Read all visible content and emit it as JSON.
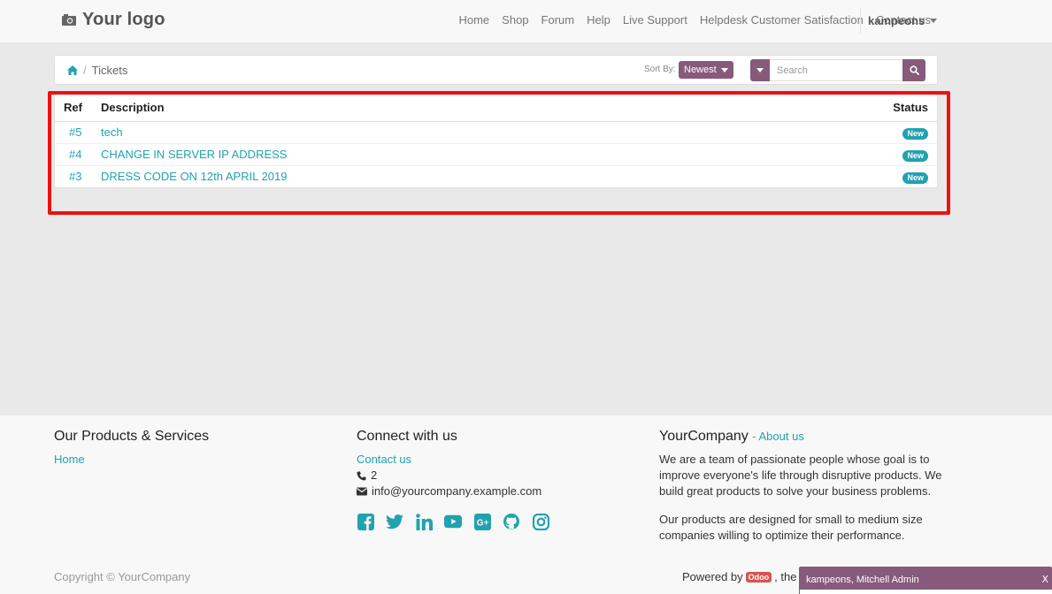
{
  "navbar": {
    "logo_text": "Your logo",
    "menu": [
      "Home",
      "Shop",
      "Forum",
      "Help",
      "Live Support",
      "Helpdesk Customer Satisfaction",
      "Contact us"
    ],
    "user": "kampeons"
  },
  "breadcrumb": {
    "home_icon": "home-icon",
    "separator": "/",
    "current": "Tickets"
  },
  "sort": {
    "label": "Sort By:",
    "value": "Newest"
  },
  "search": {
    "placeholder": "Search"
  },
  "table": {
    "headers": {
      "ref": "Ref",
      "description": "Description",
      "status": "Status"
    },
    "rows": [
      {
        "ref": "#5",
        "description": "tech",
        "status": "New"
      },
      {
        "ref": "#4",
        "description": "CHANGE IN SERVER IP ADDRESS",
        "status": "New"
      },
      {
        "ref": "#3",
        "description": "DRESS CODE ON 12th APRIL 2019",
        "status": "New"
      }
    ]
  },
  "footer": {
    "products": {
      "title": "Our Products & Services",
      "links": [
        "Home"
      ]
    },
    "connect": {
      "title": "Connect with us",
      "contact_link": "Contact us",
      "phone": "2",
      "email": "info@yourcompany.example.com",
      "social_icons": [
        "facebook-icon",
        "twitter-icon",
        "linkedin-icon",
        "youtube-icon",
        "google-plus-icon",
        "github-icon",
        "instagram-icon"
      ]
    },
    "company": {
      "title": "YourCompany",
      "about_prefix": "- ",
      "about_link": "About us",
      "p1": "We are a team of passionate people whose goal is to improve everyone's life through disruptive products. We build great products to solve your business problems.",
      "p2": "Our products are designed for small to medium size companies willing to optimize their performance."
    },
    "copyright": "Copyright © YourCompany",
    "powered_prefix": "Powered by",
    "powered_badge": "Odoo",
    "powered_suffix": ", the #"
  },
  "chat": {
    "title": "kampeons, Mitchell Admin",
    "close": "X"
  },
  "colors": {
    "brand": "#875a7b",
    "link": "#21a2b0",
    "highlight": "#ee1111",
    "odoo_badge": "#d9534f"
  }
}
